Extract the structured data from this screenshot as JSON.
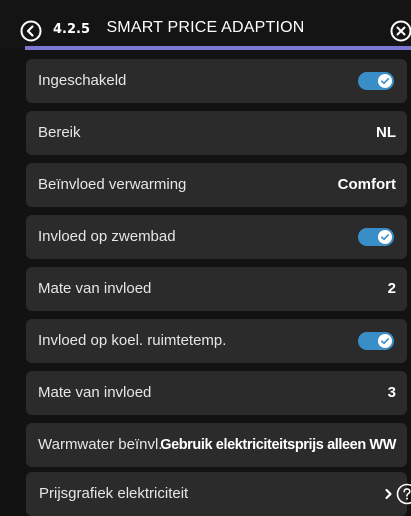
{
  "header": {
    "menu_code": "4.2.5",
    "title": "SMART PRICE ADAPTION",
    "back_icon": "back-arrow-circle-icon",
    "close_icon": "close-circle-icon"
  },
  "colors": {
    "background": "#121212",
    "row_background": "#2b2b2b",
    "accent_line": "#7c76d4",
    "toggle_on": "#3a8ec8"
  },
  "rows": [
    {
      "label": "Ingeschakeld",
      "type": "toggle",
      "on": true
    },
    {
      "label": "Bereik",
      "type": "value",
      "value": "NL"
    },
    {
      "label": "Beïnvloed verwarming",
      "type": "value",
      "value": "Comfort"
    },
    {
      "label": "Invloed op zwembad",
      "type": "toggle",
      "on": true
    },
    {
      "label": "Mate van invloed",
      "type": "value",
      "value": "2"
    },
    {
      "label": "Invloed op koel. ruimtetemp.",
      "type": "toggle",
      "on": true
    },
    {
      "label": "Mate van invloed",
      "type": "value",
      "value": "3"
    },
    {
      "label": "Warmwater beïnvl.",
      "type": "value",
      "value": "Gebruik elektriciteitsprijs alleen WW"
    },
    {
      "label": "Prijsgrafiek elektriciteit",
      "type": "link",
      "icon": "chevron-right-icon",
      "help_icon": "help-circle-icon"
    }
  ]
}
